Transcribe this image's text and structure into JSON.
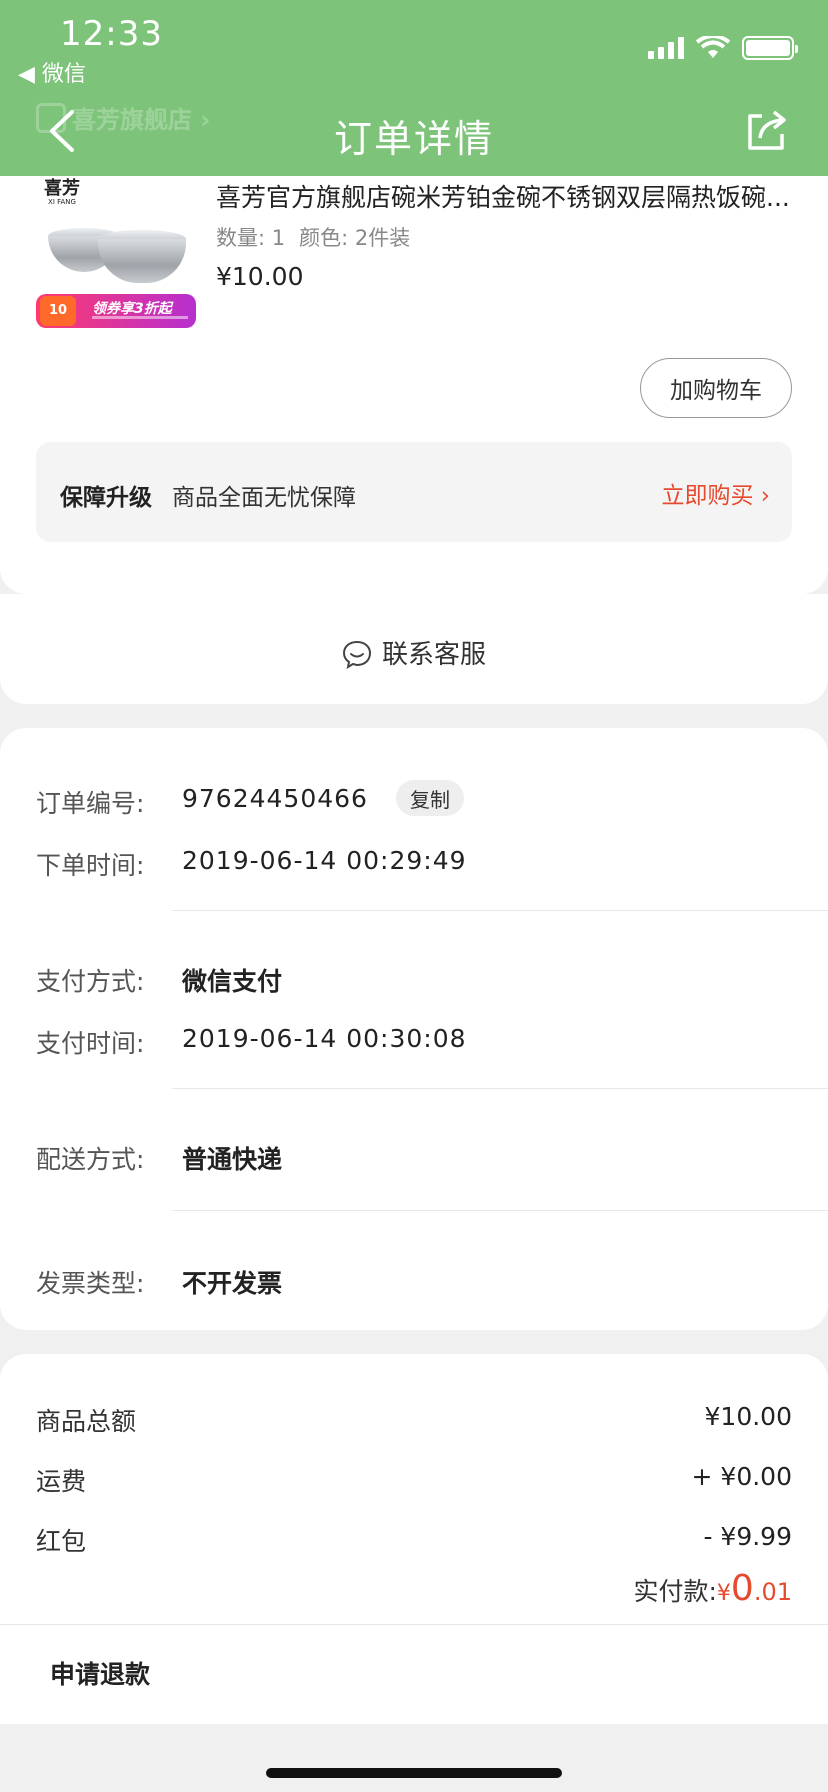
{
  "status_bar": {
    "time": "12:33",
    "back_app": "◀ 微信"
  },
  "header": {
    "ghost_store": "喜芳旗舰店 ›",
    "title": "订单详情"
  },
  "product": {
    "logo": "喜芳",
    "logo_sub": "XI FANG",
    "promo_badge": "10",
    "promo_text": "领券享3折起",
    "title": "喜芳官方旗舰店碗米芳铂金碗不锈钢双层隔热饭碗...",
    "quantity": "数量: 1",
    "color": "颜色: 2件装",
    "price": "¥10.00",
    "add_cart": "加购物车"
  },
  "guarantee": {
    "label": "保障升级",
    "desc": "商品全面无忧保障",
    "buy": "立即购买 ›"
  },
  "service": {
    "label": "联系客服"
  },
  "order_info": {
    "order_no_label": "订单编号:",
    "order_no": "97624450466",
    "copy": "复制",
    "order_time_label": "下单时间:",
    "order_time": "2019-06-14 00:29:49",
    "pay_method_label": "支付方式:",
    "pay_method": "微信支付",
    "pay_time_label": "支付时间:",
    "pay_time": "2019-06-14 00:30:08",
    "delivery_label": "配送方式:",
    "delivery": "普通快递",
    "invoice_label": "发票类型:",
    "invoice": "不开发票"
  },
  "amounts": {
    "goods_label": "商品总额",
    "goods": "¥10.00",
    "shipping_label": "运费",
    "shipping": "+ ¥0.00",
    "redpacket_label": "红包",
    "redpacket": "- ¥9.99",
    "paid_label": "实付款:",
    "paid_currency": "¥",
    "paid_int": "0",
    "paid_dec": ".01"
  },
  "bottom": {
    "refund": "申请退款"
  },
  "colors": {
    "header_green": "#7dc47a",
    "accent_red": "#e64a2e"
  }
}
